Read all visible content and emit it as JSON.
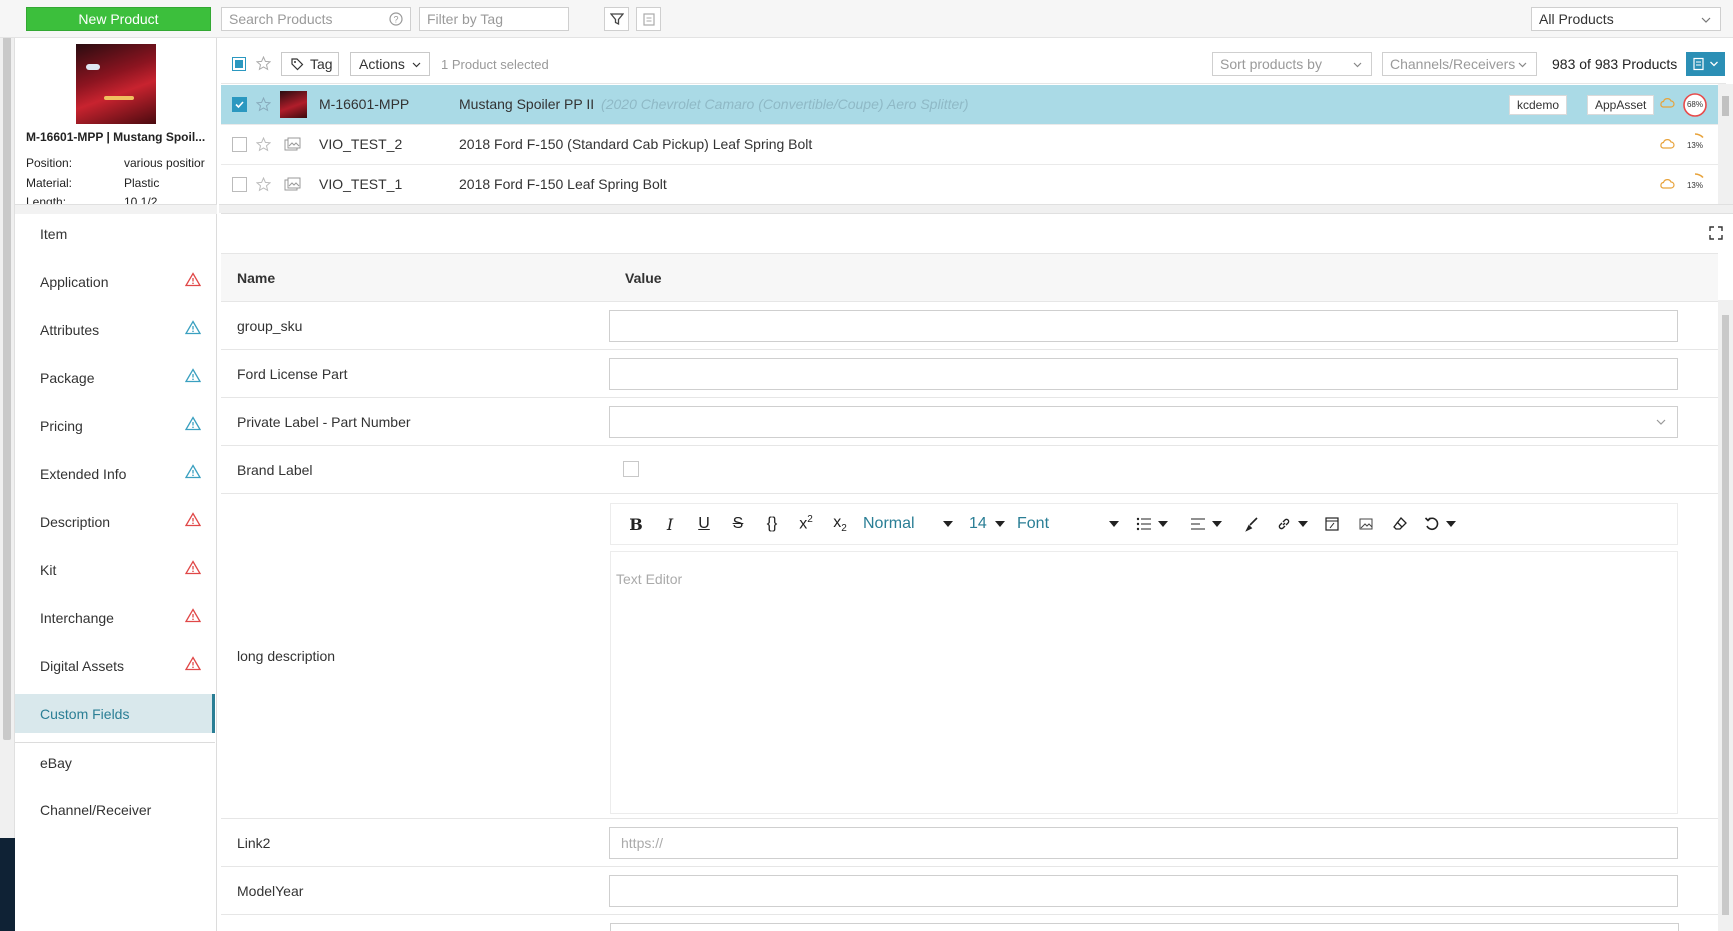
{
  "toolbar": {
    "new_product_label": "New Product",
    "search_placeholder": "Search Products",
    "filter_tag_placeholder": "Filter by Tag",
    "products_scope": "All Products"
  },
  "preview": {
    "title": "M-16601-MPP | Mustang Spoil...",
    "specs": [
      {
        "label": "Position:",
        "value": "various positior"
      },
      {
        "label": "Material:",
        "value": "Plastic"
      },
      {
        "label": "Length:",
        "value": "10 1/2"
      }
    ]
  },
  "list_toolbar": {
    "tag_label": "Tag",
    "actions_label": "Actions",
    "selected_text": "1 Product selected",
    "sort_placeholder": "Sort products by",
    "channels_placeholder": "Channels/Receivers",
    "count_text": "983 of 983 Products"
  },
  "products": [
    {
      "sku": "M-16601-MPP",
      "name": "Mustang Spoiler PP II",
      "subtitle": "(2020 Chevrolet Camaro (Convertible/Coupe) Aero Splitter)",
      "tags": [
        "kcdemo",
        "AppAsset"
      ],
      "completeness": "68%",
      "selected": true
    },
    {
      "sku": "VIO_TEST_2",
      "name": "2018 Ford F-150 (Standard Cab Pickup) Leaf Spring Bolt",
      "subtitle": "",
      "tags": [],
      "completeness": "13%",
      "selected": false
    },
    {
      "sku": "VIO_TEST_1",
      "name": "2018 Ford F-150 Leaf Spring Bolt",
      "subtitle": "",
      "tags": [],
      "completeness": "13%",
      "selected": false
    }
  ],
  "nav": {
    "items": [
      {
        "label": "Item",
        "warning": "none"
      },
      {
        "label": "Application",
        "warning": "red"
      },
      {
        "label": "Attributes",
        "warning": "blue"
      },
      {
        "label": "Package",
        "warning": "blue"
      },
      {
        "label": "Pricing",
        "warning": "blue"
      },
      {
        "label": "Extended Info",
        "warning": "blue"
      },
      {
        "label": "Description",
        "warning": "red"
      },
      {
        "label": "Kit",
        "warning": "red"
      },
      {
        "label": "Interchange",
        "warning": "red"
      },
      {
        "label": "Digital Assets",
        "warning": "red"
      },
      {
        "label": "Custom Fields",
        "warning": "none",
        "active": true
      },
      {
        "label": "eBay",
        "warning": "none"
      },
      {
        "label": "Channel/Receiver",
        "warning": "none"
      }
    ]
  },
  "custom_fields": {
    "header_name": "Name",
    "header_value": "Value",
    "fields": [
      {
        "label": "group_sku",
        "value": ""
      },
      {
        "label": "Ford License Part",
        "value": ""
      },
      {
        "label": "Private Label - Part Number",
        "value": ""
      },
      {
        "label": "Brand Label",
        "value": ""
      },
      {
        "label": "long description",
        "value": ""
      },
      {
        "label": "Link2",
        "placeholder": "https://"
      },
      {
        "label": "ModelYear",
        "value": ""
      }
    ],
    "editor": {
      "style_select": "Normal",
      "size_select": "14",
      "font_select": "Font",
      "placeholder": "Text Editor"
    }
  },
  "colors": {
    "green": "#3cbf3c",
    "accent": "#2a7e95",
    "selected_row": "#aadae6",
    "warning_red": "#e04848",
    "warning_blue": "#3aa0c0"
  }
}
